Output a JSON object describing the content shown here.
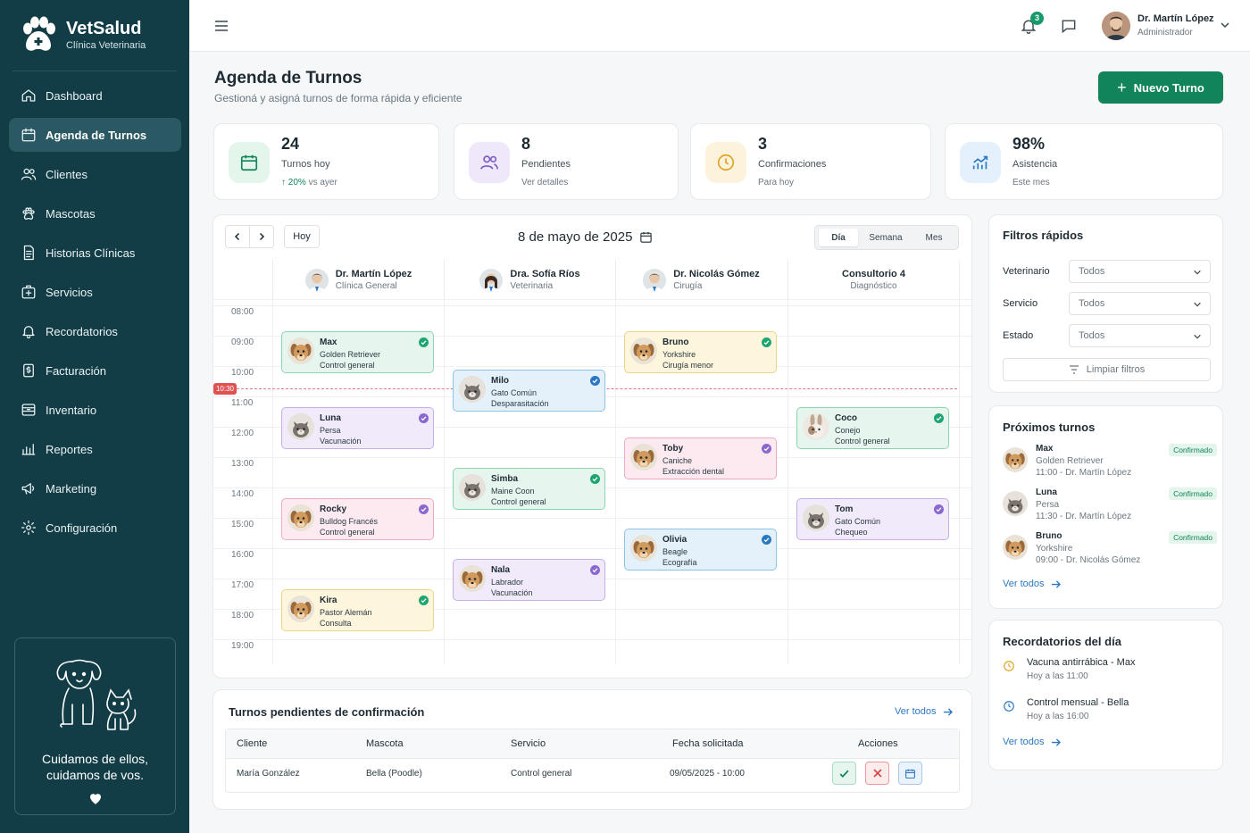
{
  "brand": {
    "name": "VetSalud",
    "subtitle": "Clínica Veterinaria"
  },
  "sidebar": {
    "items": [
      {
        "label": "Dashboard",
        "icon": "home-icon"
      },
      {
        "label": "Agenda de Turnos",
        "icon": "calendar-icon",
        "active": true
      },
      {
        "label": "Clientes",
        "icon": "users-icon"
      },
      {
        "label": "Mascotas",
        "icon": "paw-icon"
      },
      {
        "label": "Historias Clínicas",
        "icon": "document-icon"
      },
      {
        "label": "Servicios",
        "icon": "medical-kit-icon"
      },
      {
        "label": "Recordatorios",
        "icon": "bell-icon"
      },
      {
        "label": "Facturación",
        "icon": "invoice-icon"
      },
      {
        "label": "Inventario",
        "icon": "inventory-icon"
      },
      {
        "label": "Reportes",
        "icon": "bar-chart-icon"
      },
      {
        "label": "Marketing",
        "icon": "megaphone-icon"
      },
      {
        "label": "Configuración",
        "icon": "gear-icon"
      }
    ],
    "promo": {
      "line1": "Cuidamos de ellos,",
      "line2": "cuidamos de vos."
    }
  },
  "topbar": {
    "notifications_count": "3",
    "user": {
      "name": "Dr. Martín López",
      "role": "Administrador"
    }
  },
  "page": {
    "title": "Agenda de Turnos",
    "subtitle": "Gestioná y asigná turnos de forma rápida y eficiente",
    "new_button": "Nuevo Turno"
  },
  "stats": [
    {
      "value": "24",
      "label": "Turnos hoy",
      "trend": "20%",
      "sub": "vs ayer",
      "color": "#12845b"
    },
    {
      "value": "8",
      "label": "Pendientes",
      "sub": "Ver detalles",
      "color": "#7c5cc4"
    },
    {
      "value": "3",
      "label": "Confirmaciones",
      "sub": "Para hoy",
      "color": "#e0a21f"
    },
    {
      "value": "98%",
      "label": "Asistencia",
      "sub": "Este mes",
      "color": "#2b78c2"
    }
  ],
  "calendar": {
    "today_label": "Hoy",
    "date": "8 de mayo de 2025",
    "views": [
      "Día",
      "Semana",
      "Mes"
    ],
    "active_view": "Día",
    "now_time": "10:30",
    "times": [
      "08:00",
      "09:00",
      "10:00",
      "11:00",
      "12:00",
      "13:00",
      "14:00",
      "15:00",
      "16:00",
      "17:00",
      "18:00",
      "19:00"
    ],
    "columns": [
      {
        "name": "Dr. Martín López",
        "spec": "Clínica General",
        "avatar": true
      },
      {
        "name": "Dra. Sofía Ríos",
        "spec": "Veterinaria",
        "avatar": true
      },
      {
        "name": "Dr. Nicolás Gómez",
        "spec": "Cirugía",
        "avatar": true
      },
      {
        "name": "Consultorio 4",
        "spec": "Diagnóstico",
        "avatar": false
      }
    ],
    "appointments": [
      {
        "col": 0,
        "start": "09:00",
        "name": "Max",
        "breed": "Golden Retriever",
        "service": "Control general",
        "color": "green",
        "pet": "dog"
      },
      {
        "col": 0,
        "start": "11:30",
        "name": "Luna",
        "breed": "Persa",
        "service": "Vacunación",
        "color": "purple",
        "pet": "cat"
      },
      {
        "col": 0,
        "start": "14:30",
        "name": "Rocky",
        "breed": "Bulldog Francés",
        "service": "Control general",
        "color": "pink",
        "pet": "dog"
      },
      {
        "col": 0,
        "start": "17:30",
        "name": "Kira",
        "breed": "Pastor Alemán",
        "service": "Consulta",
        "color": "yellow",
        "pet": "dog"
      },
      {
        "col": 1,
        "start": "10:15",
        "name": "Milo",
        "breed": "Gato Común",
        "service": "Desparasitación",
        "color": "blue",
        "pet": "cat"
      },
      {
        "col": 1,
        "start": "13:30",
        "name": "Simba",
        "breed": "Maine Coon",
        "service": "Control general",
        "color": "green",
        "pet": "cat"
      },
      {
        "col": 1,
        "start": "16:30",
        "name": "Nala",
        "breed": "Labrador",
        "service": "Vacunación",
        "color": "purple",
        "pet": "dog"
      },
      {
        "col": 2,
        "start": "09:00",
        "name": "Bruno",
        "breed": "Yorkshire",
        "service": "Cirugía menor",
        "color": "yellow",
        "pet": "dog"
      },
      {
        "col": 2,
        "start": "12:30",
        "name": "Toby",
        "breed": "Caniche",
        "service": "Extracción dental",
        "color": "pink",
        "pet": "dog"
      },
      {
        "col": 2,
        "start": "15:30",
        "name": "Olivia",
        "breed": "Beagle",
        "service": "Ecografía",
        "color": "blue",
        "pet": "dog"
      },
      {
        "col": 3,
        "start": "11:30",
        "name": "Coco",
        "breed": "Conejo",
        "service": "Control general",
        "color": "green",
        "pet": "rabbit"
      },
      {
        "col": 3,
        "start": "14:30",
        "name": "Tom",
        "breed": "Gato Común",
        "service": "Chequeo",
        "color": "purple",
        "pet": "cat"
      }
    ]
  },
  "pending": {
    "title": "Turnos pendientes de confirmación",
    "link": "Ver todos",
    "headers": [
      "Cliente",
      "Mascota",
      "Servicio",
      "Fecha solicitada",
      "Acciones"
    ],
    "rows": [
      {
        "client": "María González",
        "pet": "Bella (Poodle)",
        "service": "Control general",
        "date": "09/05/2025 - 10:00"
      }
    ]
  },
  "filters": {
    "title": "Filtros rápidos",
    "fields": [
      {
        "label": "Veterinario",
        "value": "Todos"
      },
      {
        "label": "Servicio",
        "value": "Todos"
      },
      {
        "label": "Estado",
        "value": "Todos"
      }
    ],
    "clear": "Limpiar filtros"
  },
  "upcoming": {
    "title": "Próximos turnos",
    "items": [
      {
        "name": "Max",
        "breed": "Golden Retriever",
        "time": "11:00 - Dr. Martín López",
        "status": "Confirmado",
        "pet": "dog"
      },
      {
        "name": "Luna",
        "breed": "Persa",
        "time": "11:30 - Dr. Martín López",
        "status": "Confirmado",
        "pet": "cat"
      },
      {
        "name": "Bruno",
        "breed": "Yorkshire",
        "time": "09:00 - Dr. Nicolás Gómez",
        "status": "Confirmado",
        "pet": "dog"
      }
    ],
    "link": "Ver todos"
  },
  "reminders": {
    "title": "Recordatorios del día",
    "items": [
      {
        "title": "Vacuna antirrábica - Max",
        "sub": "Hoy a las 11:00",
        "color": "#e0a21f"
      },
      {
        "title": "Control mensual - Bella",
        "sub": "Hoy a las 16:00",
        "color": "#2b78c2"
      }
    ],
    "link": "Ver todos"
  },
  "colors": {
    "sidebar": "#123d47",
    "accent": "#12845b",
    "link": "#2b78c2",
    "danger": "#e05252"
  }
}
